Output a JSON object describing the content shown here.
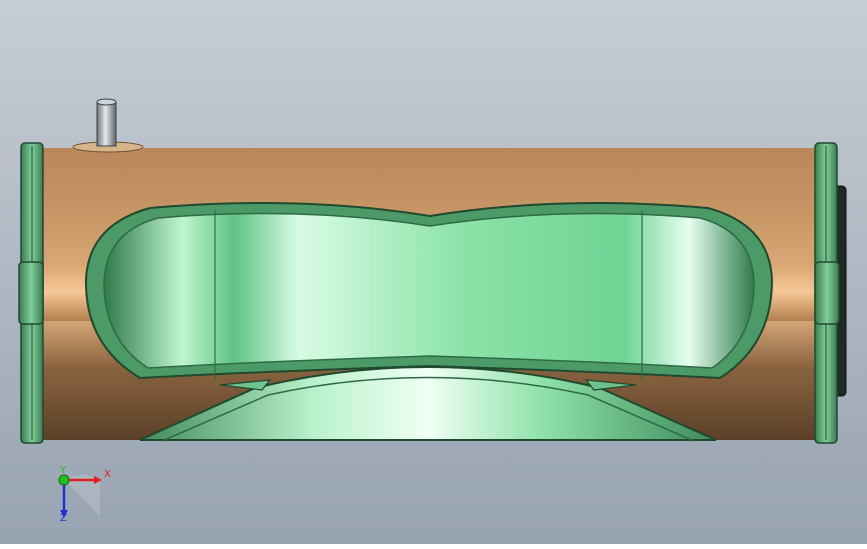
{
  "viewport": {
    "background_top": "#c7cdd5",
    "background_bottom": "#98a3b1"
  },
  "model": {
    "body_color": "#b9875a",
    "body_highlight": "#e3b07c",
    "part_green": "#8fe3a8",
    "part_green_dark": "#3f8a5b",
    "flange_color": "#4f9a6a",
    "pin_color": "#9aa0a6"
  },
  "triad": {
    "x_label": "X",
    "y_label": "Y",
    "z_label": "Z",
    "x_color": "#e02020",
    "y_color": "#20c020",
    "z_color": "#2030d0"
  }
}
